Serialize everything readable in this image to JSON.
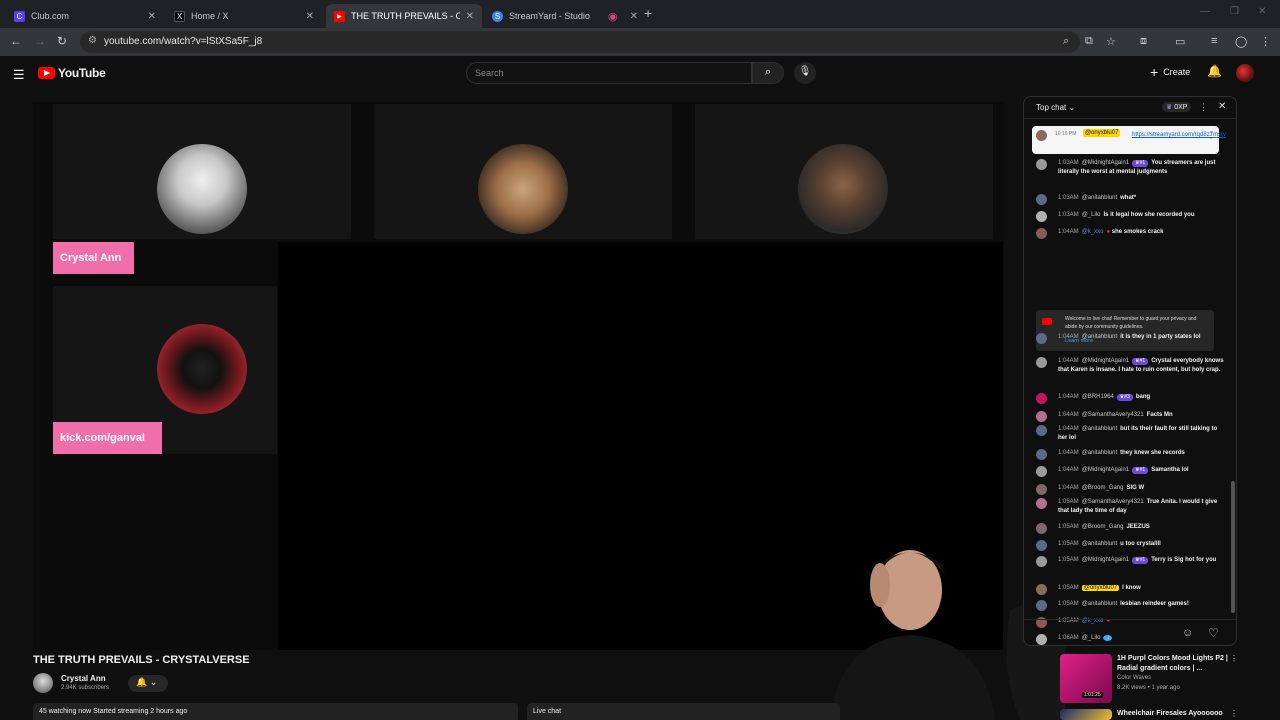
{
  "browser": {
    "tabs": [
      {
        "title": "Club.com",
        "color": "#5b3df5",
        "glyph": "C"
      },
      {
        "title": "Home / X",
        "color": "#000000",
        "glyph": "X"
      },
      {
        "title": "THE TRUTH PREVAILS - CRYSTA",
        "color": "#ff0000",
        "glyph": "▶"
      },
      {
        "title": "StreamYard - Studio",
        "color": "#3b82f6",
        "glyph": "S"
      },
      {
        "title": "",
        "color": "#d04b7a",
        "glyph": "◉"
      }
    ],
    "url": "youtube.com/watch?v=lStXSa5F_j8"
  },
  "header": {
    "logo_text": "YouTube",
    "search_placeholder": "Search",
    "create_label": "Create"
  },
  "video": {
    "participants": [
      {
        "name_chip": "Crystal Ann"
      },
      {
        "name_chip": ""
      },
      {
        "name_chip": ""
      },
      {
        "name_chip": "kick.com/ganval"
      }
    ],
    "title": "THE TRUTH PREVAILS - CRYSTALVERSE",
    "channel": "Crystal Ann",
    "subscribers": "2.94K subscribers",
    "stats": "45 watching now  Started streaming 2 hours ago",
    "livechat_label": "Live chat"
  },
  "chat": {
    "mode": "Top chat",
    "xp": "0XP",
    "pinned": {
      "time": "10:16 PM",
      "author": "@onyxblu07",
      "link": "https://streamyard.com/rqd8z7msrv"
    },
    "messages": [
      {
        "time": "1:03AM",
        "author": "@MidnightAgain1",
        "badge": "#1",
        "text": "You streamers are just literally the worst at mental judgments",
        "av": "#9a9a9a"
      },
      {
        "time": "1:03AM",
        "author": "@anitahblunt",
        "badge": "",
        "text": "what*",
        "av": "#5a6a8a"
      },
      {
        "time": "1:03AM",
        "author": "@_Lilo",
        "badge": "",
        "text": "Is it legal how she recorded you",
        "av": "#b0b0b0"
      },
      {
        "time": "1:04AM",
        "author": "@k_xxo",
        "badge": "",
        "text": "she smokes crack",
        "av": "#8a5a5a",
        "mod": true
      },
      {
        "time": "1:04AM",
        "author": "@anitahblunt",
        "badge": "",
        "text": "it is they in 1 party states lol",
        "av": "#5a6a8a"
      },
      {
        "time": "1:04AM",
        "author": "@MidnightAgain1",
        "badge": "#1",
        "text": "Crystal everybody knows that Karen is insane. I hate to ruin content, but holy crap.",
        "av": "#9a9a9a"
      },
      {
        "time": "1:04AM",
        "author": "@BRH1964",
        "badge": "#3",
        "text": "bang",
        "av": "#c2185b"
      },
      {
        "time": "1:04AM",
        "author": "@SamanthaAvery4321",
        "badge": "",
        "text": "Facts Mn",
        "av": "#b07090"
      },
      {
        "time": "1:04AM",
        "author": "@anitahblunt",
        "badge": "",
        "text": "but its their fault for still talking to her lol",
        "av": "#5a6a8a"
      },
      {
        "time": "1:04AM",
        "author": "@anitahblunt",
        "badge": "",
        "text": "they knew she records",
        "av": "#5a6a8a"
      },
      {
        "time": "1:04AM",
        "author": "@MidnightAgain1",
        "badge": "#1",
        "text": "Samantha lol",
        "av": "#9a9a9a"
      },
      {
        "time": "1:04AM",
        "author": "@Broom_Gang",
        "badge": "",
        "text": "SIG W",
        "av": "#7a6a6a"
      },
      {
        "time": "1:05AM",
        "author": "@SamanthaAvery4321",
        "badge": "",
        "text": "True Anita. I would t give that lady the time of day",
        "av": "#b07090"
      },
      {
        "time": "1:05AM",
        "author": "@Broom_Gang",
        "badge": "",
        "text": "JEEZUS",
        "av": "#7a6a6a"
      },
      {
        "time": "1:05AM",
        "author": "@anitahblunt",
        "badge": "",
        "text": "u too crystallll",
        "av": "#5a6a8a"
      },
      {
        "time": "1:05AM",
        "author": "@MidnightAgain1",
        "badge": "#1",
        "text": "Terry is Sig hot for you",
        "av": "#9a9a9a"
      },
      {
        "time": "1:05AM",
        "author": "@onyxblu07",
        "badge": "",
        "text": "I know",
        "av": "#8a6a5a",
        "hl": true
      },
      {
        "time": "1:05AM",
        "author": "@anitahblunt",
        "badge": "",
        "text": "lesbian reindeer games!",
        "av": "#5a6a8a"
      },
      {
        "time": "1:05AM",
        "author": "@k_xxo",
        "badge": "",
        "text": "",
        "av": "#8a5a5a",
        "mod": true
      },
      {
        "time": "1:06AM",
        "author": "@_Lilo",
        "badge": "",
        "text": "",
        "av": "#b0b0b0"
      }
    ],
    "welcome_text": "Welcome to live chat! Remember to guard your privacy and abide by our community guidelines.",
    "learn_more": "Learn more"
  },
  "recommendations": [
    {
      "title": "1H Purpl Colors Mood Lights P2 | Radial gradient colors | ...",
      "channel": "Color Waves",
      "meta": "8.2K views • 1 year ago",
      "duration": "1:01:25",
      "thumb": "#b0106a"
    },
    {
      "title": "Wheelchair Firesales Ayoooooo",
      "channel": "",
      "meta": "",
      "duration": "",
      "thumb": "#1a2a6a"
    }
  ]
}
